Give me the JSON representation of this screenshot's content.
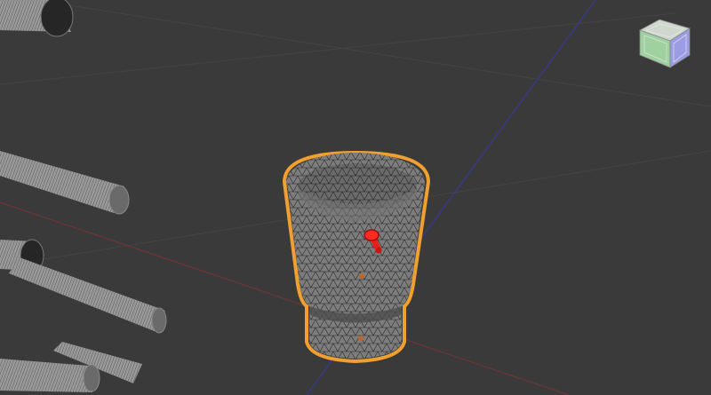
{
  "viewport": {
    "background": "#3a3a3a",
    "grid_color": "#474747",
    "axis_x_color": "#7a3a3a",
    "axis_y_color": "#3d3d8c",
    "selection_color": "#f0a030",
    "gizmo_color": "#e8201c",
    "mesh_color": "#8a8a8a"
  },
  "selected_object": {
    "name": "",
    "shading": "wireframe-on-shaded"
  },
  "view_cube": {
    "faces": [
      "top",
      "front",
      "right"
    ],
    "colors": {
      "top": "#cfd7cf",
      "front": "#9fd09f",
      "right": "#9b9be6"
    }
  }
}
